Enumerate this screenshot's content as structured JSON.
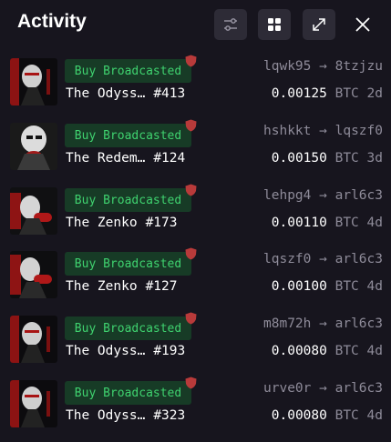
{
  "header": {
    "title": "Activity",
    "buttons": [
      {
        "icon": "filter-sliders-icon"
      },
      {
        "icon": "grid-view-icon"
      },
      {
        "icon": "expand-icon"
      },
      {
        "icon": "close-icon"
      }
    ]
  },
  "colors": {
    "background": "#17151e",
    "badge_bg": "#173b26",
    "badge_text": "#3fd26f",
    "shield": "#b83a3a",
    "muted": "#8e8b99"
  },
  "activity": [
    {
      "status": "Buy Broadcasted",
      "name": "The Odyss…",
      "number": "#413",
      "from": "lqwk95",
      "arrow": "→",
      "to": "8tzjzu",
      "amount": "0.00125",
      "currency": "BTC",
      "age": "2d"
    },
    {
      "status": "Buy Broadcasted",
      "name": "The Redem…",
      "number": "#124",
      "from": "hshkkt",
      "arrow": "→",
      "to": "lqszf0",
      "amount": "0.00150",
      "currency": "BTC",
      "age": "3d"
    },
    {
      "status": "Buy Broadcasted",
      "name": "The Zenko",
      "number": "#173",
      "from": "lehpg4",
      "arrow": "→",
      "to": "arl6c3",
      "amount": "0.00110",
      "currency": "BTC",
      "age": "4d"
    },
    {
      "status": "Buy Broadcasted",
      "name": "The Zenko",
      "number": "#127",
      "from": "lqszf0",
      "arrow": "→",
      "to": "arl6c3",
      "amount": "0.00100",
      "currency": "BTC",
      "age": "4d"
    },
    {
      "status": "Buy Broadcasted",
      "name": "The Odyss…",
      "number": "#193",
      "from": "m8m72h",
      "arrow": "→",
      "to": "arl6c3",
      "amount": "0.00080",
      "currency": "BTC",
      "age": "4d"
    },
    {
      "status": "Buy Broadcasted",
      "name": "The Odyss…",
      "number": "#323",
      "from": "urve0r",
      "arrow": "→",
      "to": "arl6c3",
      "amount": "0.00080",
      "currency": "BTC",
      "age": "4d"
    }
  ]
}
